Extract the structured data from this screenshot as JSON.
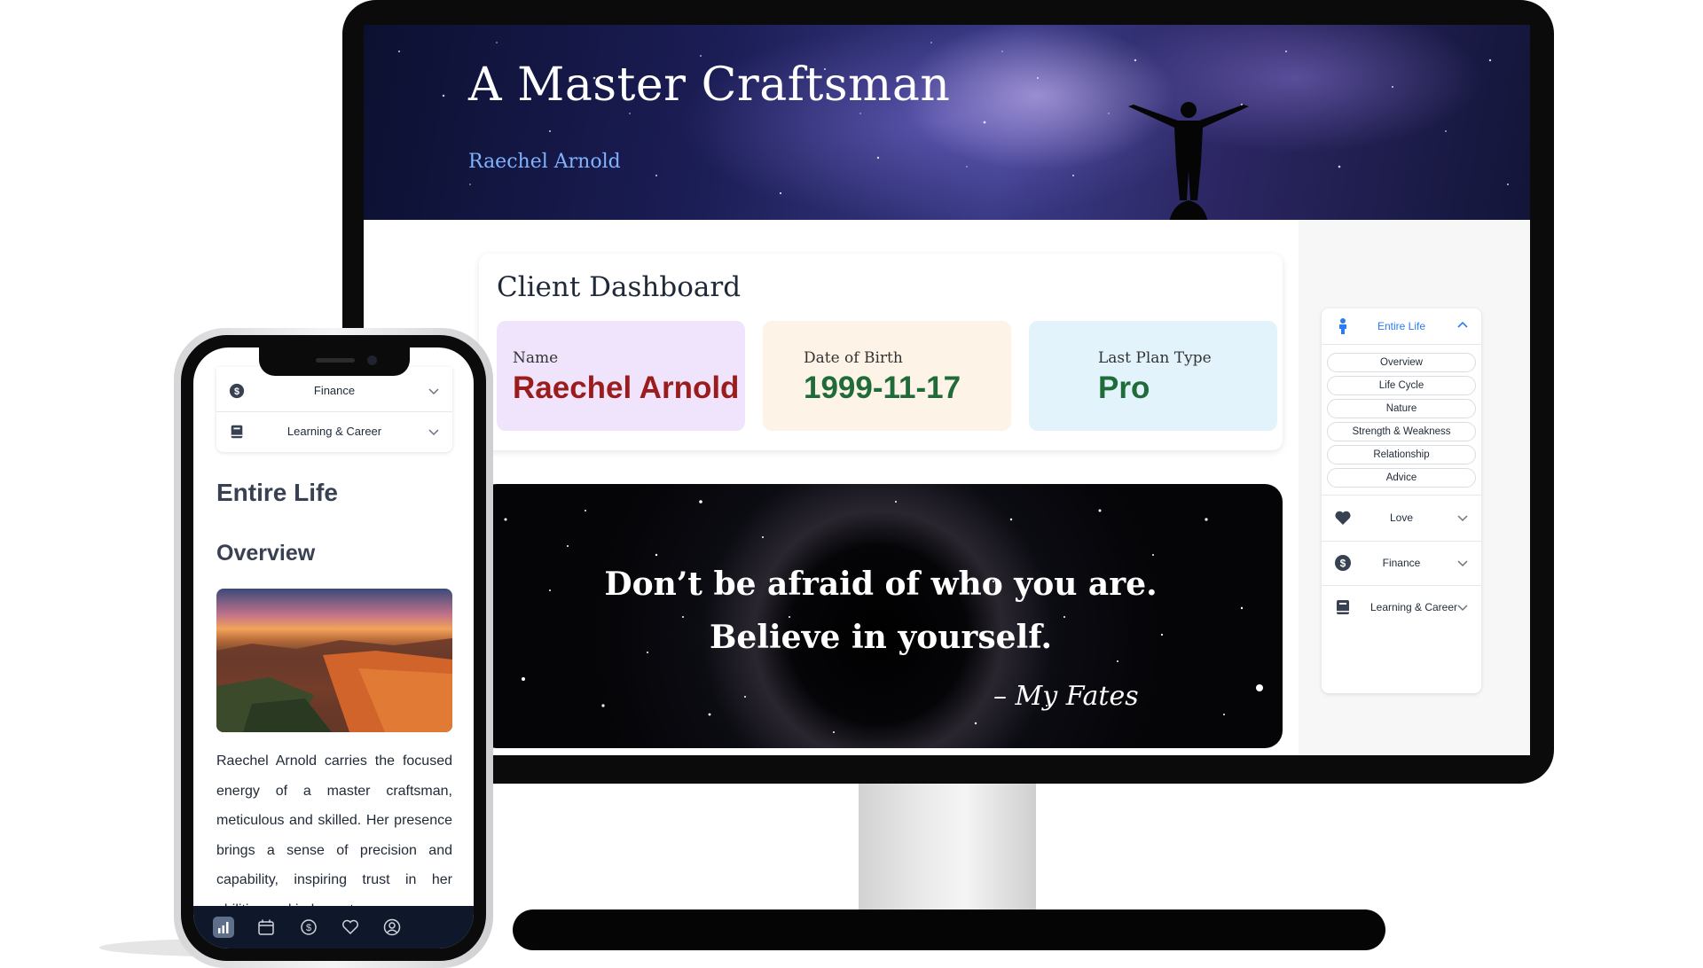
{
  "desktop": {
    "hero": {
      "title": "A Master Craftsman",
      "subtitle": "Raechel Arnold"
    },
    "dashboard": {
      "title": "Client Dashboard",
      "cards": [
        {
          "label": "Name",
          "value": "Raechel Arnold",
          "value_color": "#9b1c1c",
          "bg": "#efe4fb"
        },
        {
          "label": "Date of Birth",
          "value": "1999-11-17",
          "value_color": "#1f6b3a",
          "bg": "#fdf3e6"
        },
        {
          "label": "Last Plan Type",
          "value": "Pro",
          "value_color": "#1f6b3a",
          "bg": "#e3f3fb"
        }
      ]
    },
    "quote": {
      "line1": "Don’t be afraid of who you are.",
      "line2": "Believe in yourself.",
      "signature": "– My Fates"
    },
    "sidebar": {
      "accent_color": "#2b7bf1",
      "active_section": {
        "label": "Entire Life",
        "icon": "person-icon",
        "expanded": true
      },
      "sub_items": [
        "Overview",
        "Life Cycle",
        "Nature",
        "Strength & Weakness",
        "Relationship",
        "Advice"
      ],
      "sections": [
        {
          "label": "Love",
          "icon": "heart-icon"
        },
        {
          "label": "Finance",
          "icon": "dollar-icon"
        },
        {
          "label": "Learning & Career",
          "icon": "book-icon"
        }
      ]
    }
  },
  "mobile": {
    "menu": [
      {
        "label": "Finance",
        "icon": "dollar-icon"
      },
      {
        "label": "Learning & Career",
        "icon": "book-icon"
      }
    ],
    "heading": "Entire Life",
    "subheading": "Overview",
    "image_alt": "canyon-sunset-image",
    "paragraph": "Raechel Arnold carries the focused energy of a master craftsman, meticulous and skilled. Her presence brings a sense of precision and capability, inspiring trust in her abilities and judgment.",
    "tabbar": [
      "chart-icon",
      "calendar-icon",
      "dollar-icon",
      "heart-icon",
      "user-circle-icon"
    ]
  }
}
